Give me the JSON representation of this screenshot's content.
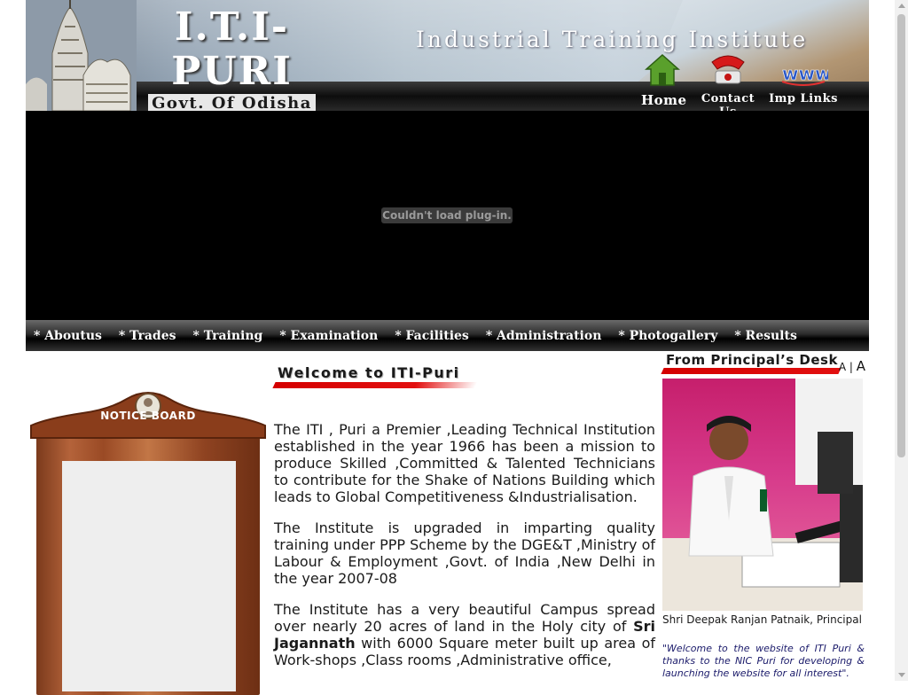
{
  "header": {
    "brand_title": "I.T.I-PURI",
    "brand_subtitle": "Govt. Of Odisha",
    "institute_name": "Industrial Training Institute",
    "nav": [
      {
        "label": "Home",
        "icon": "house-icon"
      },
      {
        "label": "Contact Us",
        "icon": "phone-icon"
      },
      {
        "label": "Imp Links",
        "icon": "www-icon"
      }
    ]
  },
  "plugin": {
    "message": "Couldn't load plug-in."
  },
  "menu": {
    "items": [
      "* Aboutus",
      "* Trades",
      "* Training",
      "* Examination",
      "* Facilities",
      "* Administration",
      "* Photogallery",
      "* Results"
    ]
  },
  "notice": {
    "title": "NOTICE  BOARD"
  },
  "welcome": {
    "heading": "Welcome to ITI-Puri",
    "paragraphs": [
      "The ITI , Puri a Premier ,Leading Technical Institution established in the year 1966 has been a mission to produce Skilled ,Committed & Talented Technicians to contribute for the Shake of Nations Building which leads to Global Competitiveness &Industrialisation.",
      "The Institute is upgraded in imparting quality training under PPP Scheme by the DGE&T ,Ministry of Labour & Employment ,Govt. of India ,New Delhi in the year 2007-08"
    ],
    "p3_before": "The Institute has a very beautiful Campus spread over nearly 20 acres of land in the Holy city of ",
    "p3_bold": "Sri Jagannath",
    "p3_after": " with 6000 Square meter built up area of Work-shops ,Class rooms ,Administrative office,"
  },
  "principal": {
    "heading": "From Principal’s Desk",
    "font_small": "A",
    "font_separator": "|",
    "font_large": "A",
    "name": "Shri Deepak Ranjan Patnaik, Principal",
    "quote": "\"Welcome to the website of ITI Puri & thanks to the NIC Puri for developing & launching the website for all interest\"."
  },
  "colors": {
    "accent_red": "#e21010",
    "menu_bg": "#000000",
    "frame_wood": "#9a4a25"
  }
}
